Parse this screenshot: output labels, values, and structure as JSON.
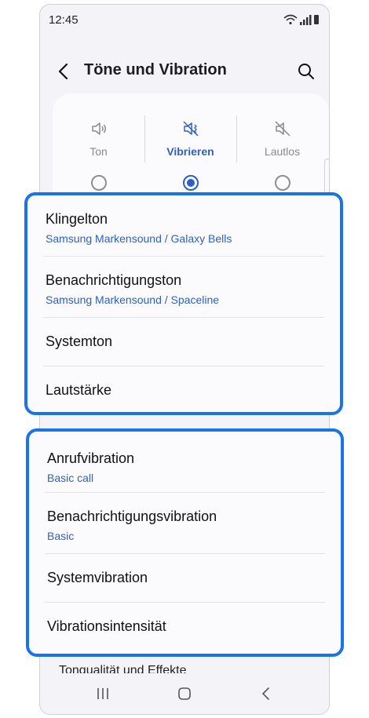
{
  "status_bar": {
    "time": "12:45"
  },
  "header": {
    "title": "Töne und Vibration"
  },
  "modes": [
    {
      "label": "Ton",
      "selected": false
    },
    {
      "label": "Vibrieren",
      "selected": true
    },
    {
      "label": "Lautlos",
      "selected": false
    }
  ],
  "sound_group": [
    {
      "title": "Klingelton",
      "subtitle": "Samsung Markensound / Galaxy Bells"
    },
    {
      "title": "Benachrichtigungston",
      "subtitle": "Samsung Markensound / Spaceline"
    },
    {
      "title": "Systemton"
    },
    {
      "title": "Lautstärke"
    }
  ],
  "vibration_group": [
    {
      "title": "Anrufvibration",
      "subtitle": "Basic call"
    },
    {
      "title": "Benachrichtigungsvibration",
      "subtitle": "Basic"
    },
    {
      "title": "Systemvibration"
    },
    {
      "title": "Vibrationsintensität"
    }
  ],
  "footer": {
    "next_item": "Tonqualität und Effekte"
  },
  "colors": {
    "accent": "#2d5fc8",
    "highlight_border": "#1a73e8"
  }
}
